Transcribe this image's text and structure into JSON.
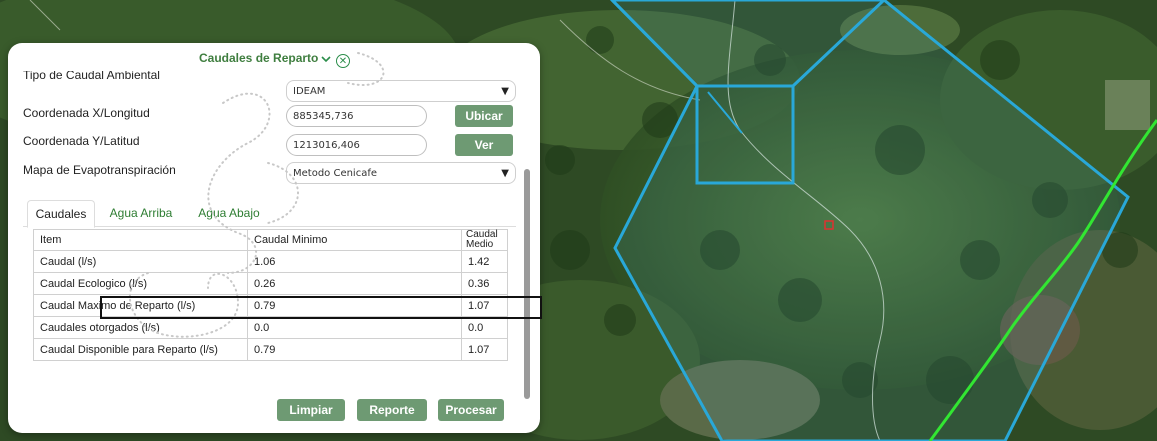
{
  "panel": {
    "title": "Caudales de Reparto",
    "fields": {
      "caudal_ambiental_label": "Tipo de Caudal Ambiental",
      "caudal_ambiental_value": "IDEAM",
      "coord_x_label": "Coordenada X/Longitud",
      "coord_x_value": "885345,736",
      "coord_y_label": "Coordenada Y/Latitud",
      "coord_y_value": "1213016,406",
      "evapo_label": "Mapa de Evapotranspiración",
      "evapo_value": "Metodo Cenicafe"
    },
    "buttons": {
      "ubicar": "Ubicar",
      "ver": "Ver",
      "limpiar": "Limpiar",
      "reporte": "Reporte",
      "procesar": "Procesar"
    },
    "tabs": [
      "Caudales",
      "Agua Arriba",
      "Agua Abajo"
    ],
    "table": {
      "headers": [
        "Item",
        "Caudal Minimo",
        "Caudal Medio"
      ],
      "rows": [
        [
          "Caudal (l/s)",
          "1.06",
          "1.42"
        ],
        [
          "Caudal Ecologico (l/s)",
          "0.26",
          "0.36"
        ],
        [
          "Caudal Maximo de Reparto (l/s)",
          "0.79",
          "1.07"
        ],
        [
          "Caudales otorgados (l/s)",
          "0.0",
          "0.0"
        ],
        [
          "Caudal Disponible para Reparto (l/s)",
          "0.79",
          "1.07"
        ]
      ]
    }
  },
  "colors": {
    "accent_green": "#6e9a73",
    "title_green": "#3f7e3f",
    "polygon_blue": "#29a8d8",
    "line_green": "#32e632"
  }
}
